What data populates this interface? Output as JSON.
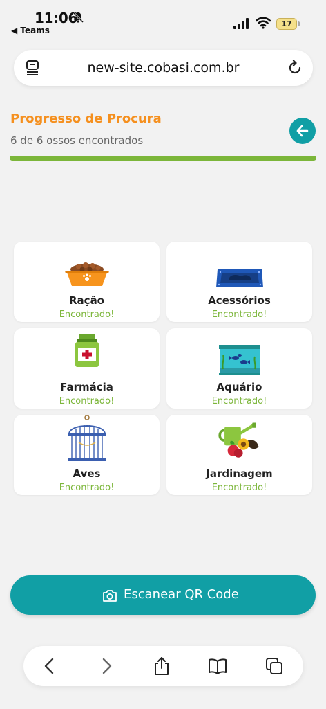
{
  "status": {
    "time": "11:06",
    "back_app": "◀ Teams",
    "battery": "17"
  },
  "browser": {
    "url": "new-site.cobasi.com.br"
  },
  "progress": {
    "title": "Progresso de Procura",
    "subtitle": "6 de 6 ossos encontrados",
    "fraction": 1.0
  },
  "categories": [
    {
      "name": "Ração",
      "status": "Encontrado!",
      "icon": "food-bowl-icon"
    },
    {
      "name": "Acessórios",
      "status": "Encontrado!",
      "icon": "pet-bed-icon"
    },
    {
      "name": "Farmácia",
      "status": "Encontrado!",
      "icon": "medicine-bottle-icon"
    },
    {
      "name": "Aquário",
      "status": "Encontrado!",
      "icon": "aquarium-icon"
    },
    {
      "name": "Aves",
      "status": "Encontrado!",
      "icon": "birdcage-icon"
    },
    {
      "name": "Jardinagem",
      "status": "Encontrado!",
      "icon": "gardening-icon"
    }
  ],
  "scan_button": {
    "label": "Escanear QR Code"
  },
  "colors": {
    "accent": "#119fa5",
    "orange": "#f5901f",
    "green": "#7cb63a"
  }
}
